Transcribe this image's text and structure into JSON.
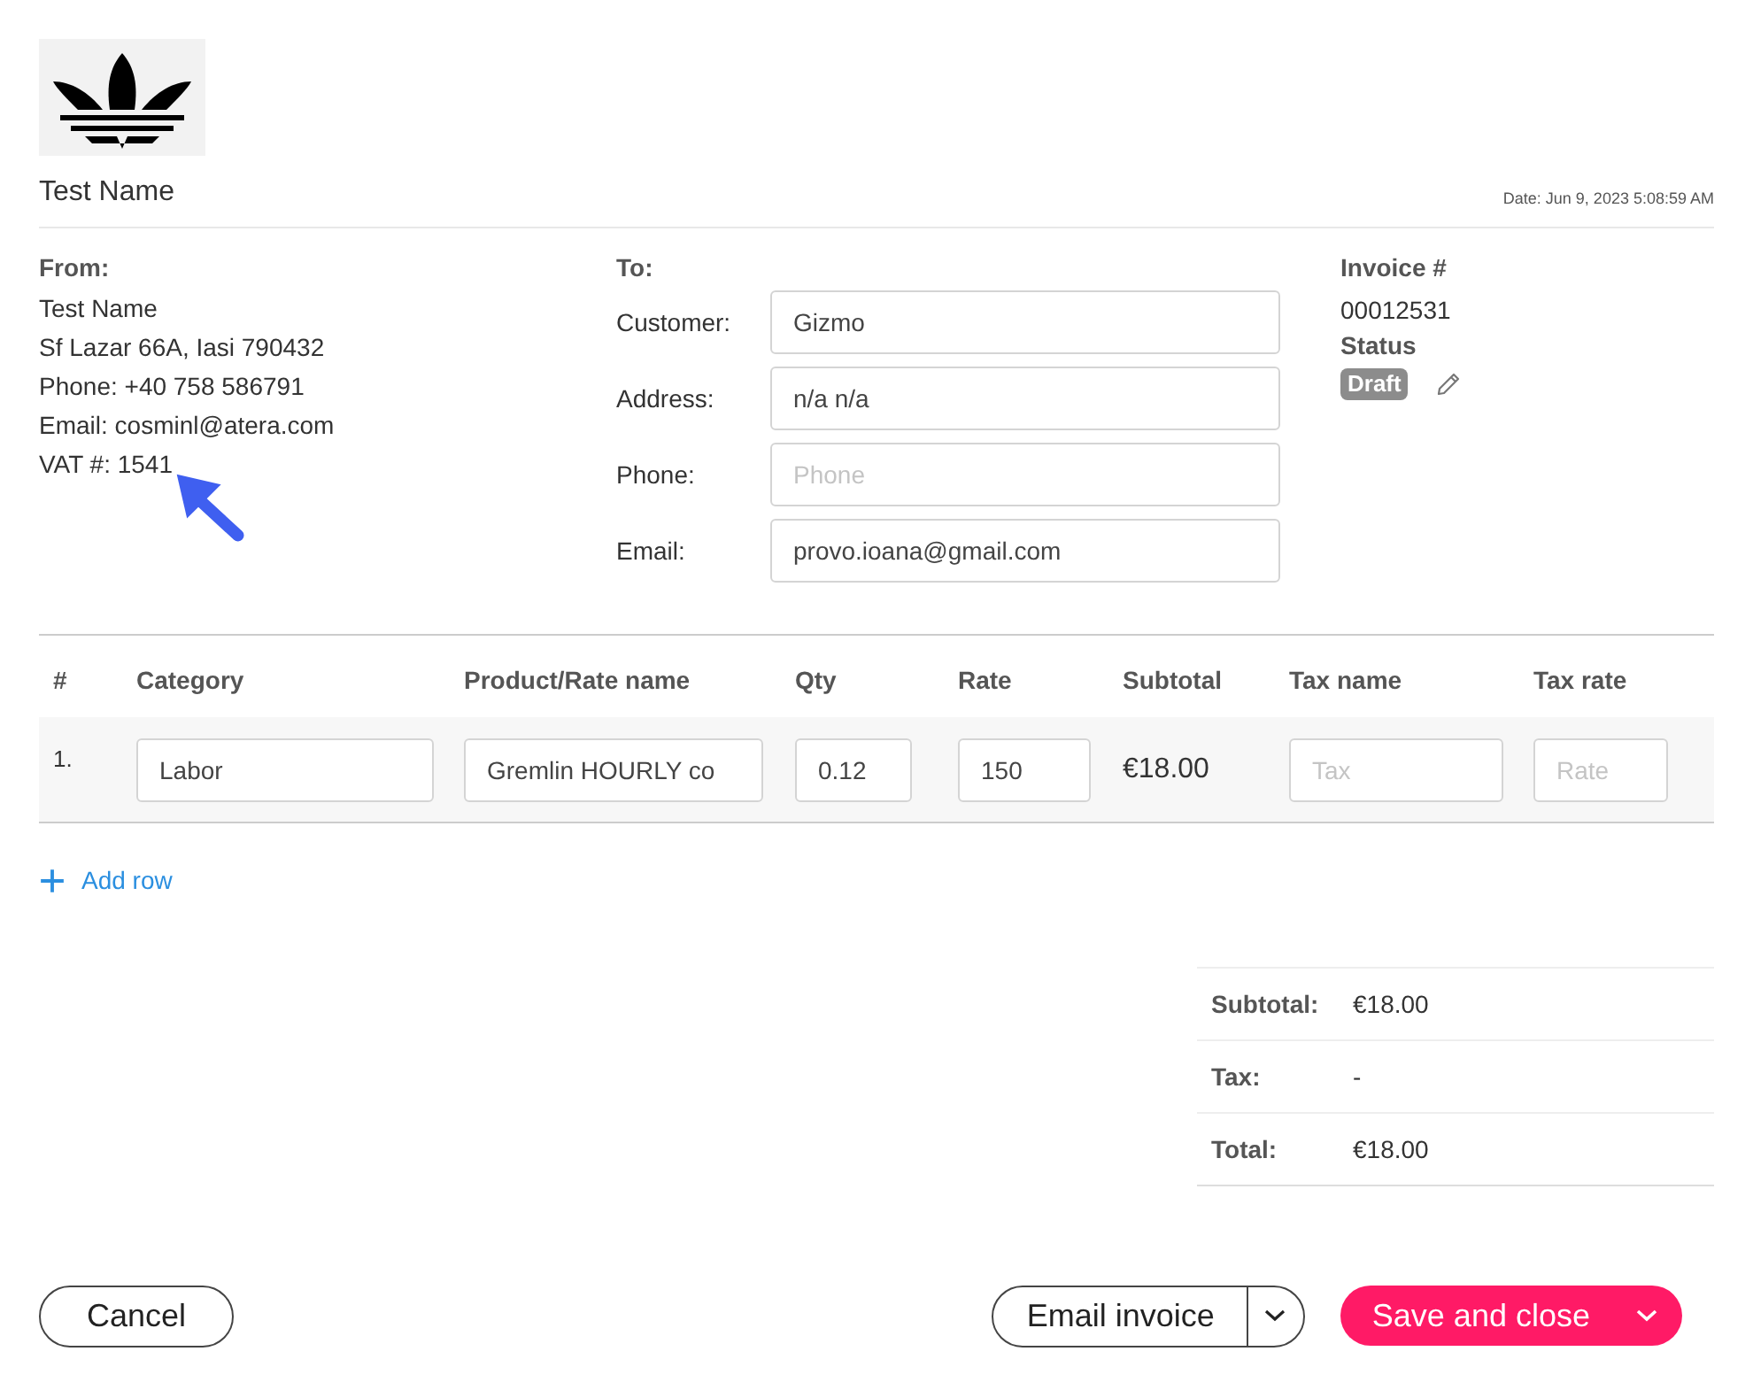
{
  "header": {
    "company_name": "Test Name",
    "date": "Date:  Jun 9, 2023 5:08:59 AM"
  },
  "from": {
    "heading": "From:",
    "lines": [
      "Test Name",
      "Sf Lazar 66A, Iasi 790432",
      "Phone: +40 758 586791",
      "Email: cosminl@atera.com",
      "VAT #: 1541"
    ]
  },
  "to": {
    "heading": "To:",
    "fields": [
      {
        "label": "Customer:",
        "value": "Gizmo"
      },
      {
        "label": "Address:",
        "value": "n/a n/a"
      },
      {
        "label": "Phone:",
        "placeholder": "Phone"
      },
      {
        "label": "Email:",
        "value": "provo.ioana@gmail.com"
      }
    ]
  },
  "invoice": {
    "number_label": "Invoice #",
    "number": "00012531",
    "status_label": "Status",
    "status": "Draft"
  },
  "items": {
    "columns": [
      "#",
      "Category",
      "Product/Rate name",
      "Qty",
      "Rate",
      "Subtotal",
      "Tax name",
      "Tax rate"
    ],
    "rows": [
      {
        "number": "1.",
        "category": "Labor",
        "product": "Gremlin HOURLY co",
        "qty": "0.12",
        "rate": "150",
        "subtotal": "€18.00",
        "tax_name_placeholder": "Tax",
        "tax_rate_placeholder": "Rate"
      }
    ]
  },
  "add_row": "Add row",
  "totals": [
    {
      "label": "Subtotal:",
      "value": "€18.00"
    },
    {
      "label": "Tax:",
      "value": "-"
    },
    {
      "label": "Total:",
      "value": "€18.00"
    }
  ],
  "buttons": {
    "cancel": "Cancel",
    "email_invoice": "Email invoice",
    "save_and_close": "Save and close"
  }
}
